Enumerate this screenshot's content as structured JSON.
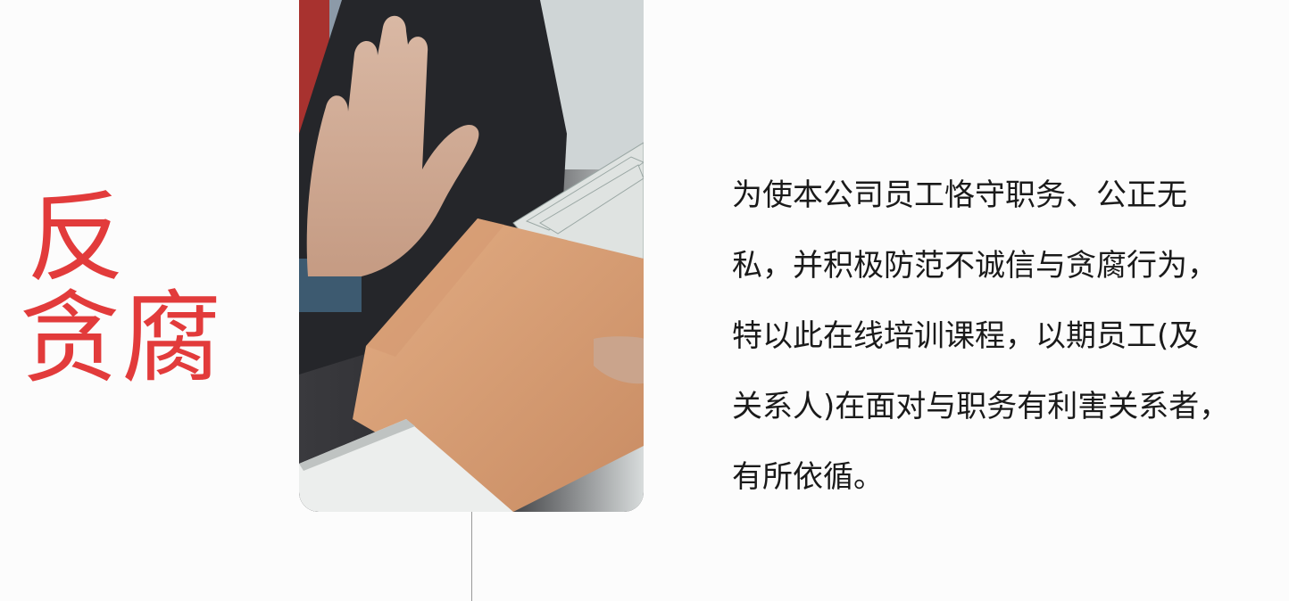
{
  "slide": {
    "title_line1": "反",
    "title_line2": "贪腐",
    "title_color": "#e23b3b",
    "paragraph_lines": [
      "为使本公司员工恪守职务、公正无",
      "私，并积极防范不诚信与贪腐行为，",
      "特以此在线培训课程，以期员工(及",
      "关系人)在面对与职务有利害关系者，",
      "有所依循。"
    ]
  },
  "image": {
    "subject": "hand refusing an envelope of money"
  }
}
